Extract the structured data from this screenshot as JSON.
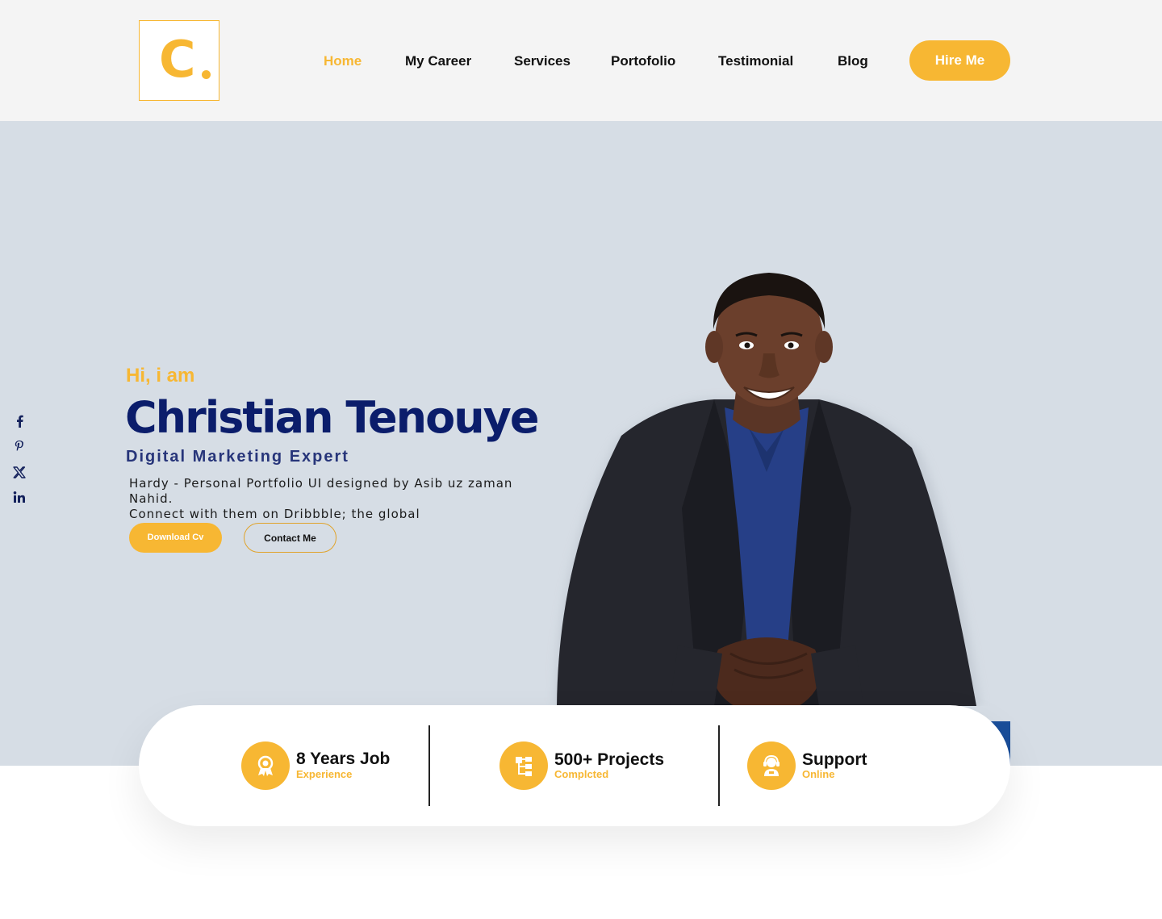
{
  "header": {
    "logo_letter": "C",
    "nav": [
      {
        "label": "Home",
        "active": true
      },
      {
        "label": "My Career",
        "active": false
      },
      {
        "label": "Services",
        "active": false
      },
      {
        "label": "Portofolio",
        "active": false
      },
      {
        "label": "Testimonial",
        "active": false
      },
      {
        "label": "Blog",
        "active": false
      }
    ],
    "hire_label": "Hire Me"
  },
  "hero": {
    "greeting": "Hi, i am",
    "name": "Christian Tenouye",
    "role": "Digital Marketing Expert",
    "description_line1": "Hardy - Personal Portfolio UI designed by Asib uz zaman Nahid.",
    "description_line2": "Connect with them on Dribbble; the global",
    "download_label": "Download Cv",
    "contact_label": "Contact Me",
    "socials": [
      "facebook-icon",
      "pinterest-icon",
      "x-icon",
      "linkedin-icon"
    ]
  },
  "stats": [
    {
      "title": "8 Years Job",
      "subtitle": "Experience",
      "icon": "award-icon"
    },
    {
      "title": "500+ Projects",
      "subtitle": "Complcted",
      "icon": "project-tree-icon"
    },
    {
      "title": "Support",
      "subtitle": "Online",
      "icon": "support-agent-icon"
    }
  ],
  "colors": {
    "accent": "#f7b733",
    "navy": "#0b1d6b",
    "hero_bg": "#d6dde5",
    "header_bg": "#f4f4f4"
  }
}
